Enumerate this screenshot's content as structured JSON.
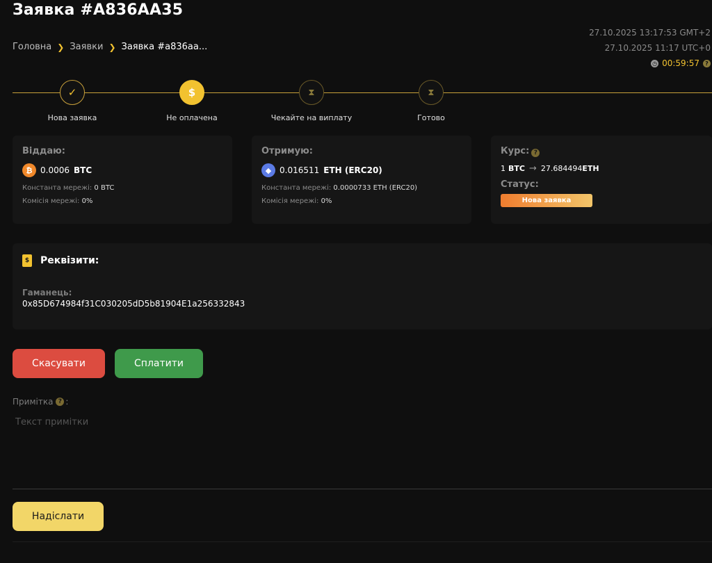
{
  "page": {
    "title": "Заявка #A836AA35"
  },
  "breadcrumb": {
    "home": "Головна",
    "orders": "Заявки",
    "current": "Заявка #a836aa..."
  },
  "times": {
    "local": "27.10.2025 13:17:53 GMT+2",
    "utc": "27.10.2025 11:17 UTC+0",
    "timer": "00:59:57"
  },
  "steps": [
    {
      "label": "Нова заявка",
      "state": "done"
    },
    {
      "label": "Не оплачена",
      "state": "active"
    },
    {
      "label": "Чекайте на виплату",
      "state": "pending"
    },
    {
      "label": "Готово",
      "state": "pending"
    }
  ],
  "give": {
    "heading": "Віддаю:",
    "amount": "0.0006",
    "currency": "BTC",
    "network_const_label": "Константа мережі:",
    "network_const_value": "0 BTC",
    "fee_label": "Комісія мережі:",
    "fee_value": "0%"
  },
  "receive": {
    "heading": "Отримую:",
    "amount": "0.016511",
    "currency": "ETH (ERC20)",
    "network_const_label": "Константа мережі:",
    "network_const_value": "0.0000733 ETH (ERC20)",
    "fee_label": "Комісія мережі:",
    "fee_value": "0%"
  },
  "rate": {
    "heading": "Курс:",
    "from_amount": "1",
    "from_currency": "BTC",
    "to_amount": "27.684494",
    "to_currency": "ETH",
    "status_label": "Статус:",
    "status_value": "Нова заявка"
  },
  "requisites": {
    "heading": "Реквізити:",
    "wallet_label": "Гаманець:",
    "wallet_value": "0x85D674984f31C030205dD5b81904E1a256332843"
  },
  "actions": {
    "cancel": "Скасувати",
    "pay": "Сплатити",
    "send": "Надіслати"
  },
  "note": {
    "label": "Примітка",
    "colon": ":",
    "placeholder": "Текст примітки"
  },
  "icons": {
    "coin_btc": "₿",
    "coin_eth": "◆",
    "check": "✓",
    "dollar": "$",
    "hourglass": "⧗",
    "arrow": "→",
    "question": "?",
    "clock": "◷"
  },
  "colors": {
    "accent": "#f2c230",
    "cancel": "#dc4c40",
    "pay": "#3f9a4b",
    "send": "#f2d668",
    "background": "#0f0f0f",
    "card": "#161616"
  }
}
